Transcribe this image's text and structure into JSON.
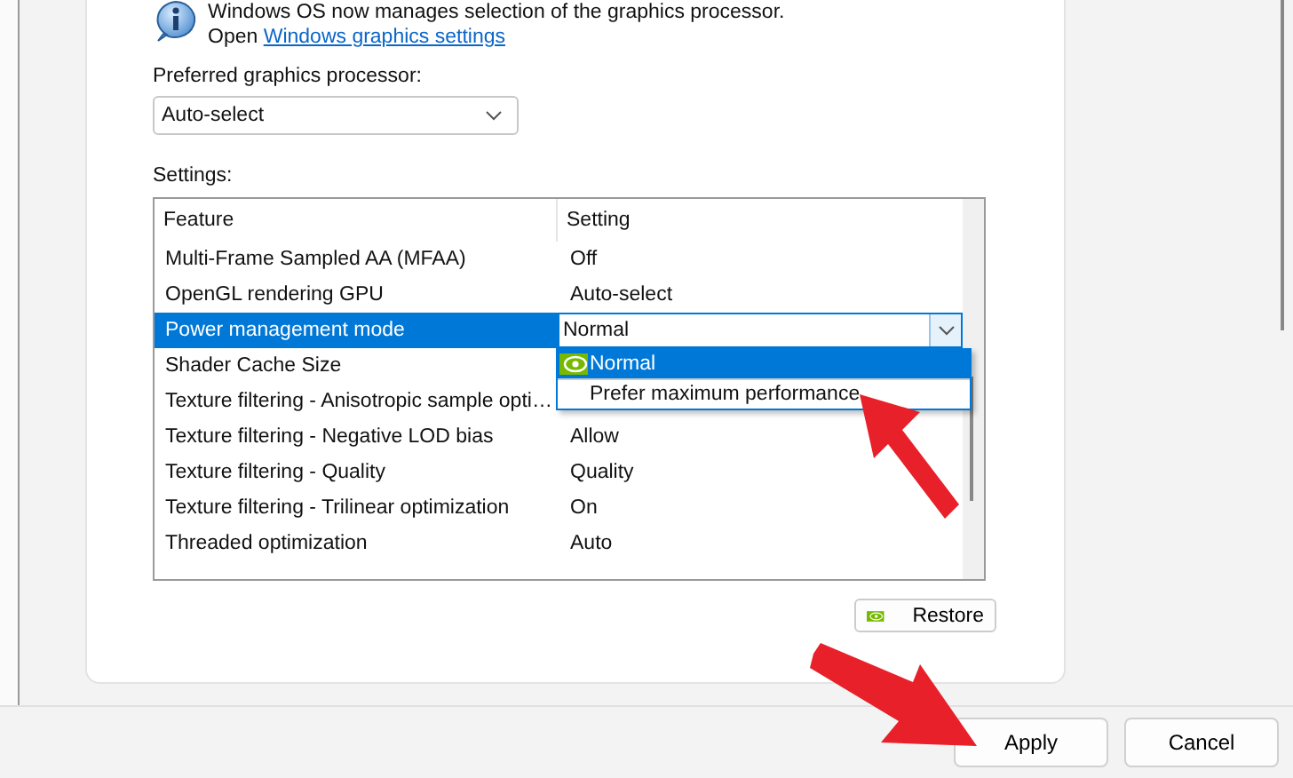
{
  "info": {
    "message": "Windows OS now manages selection of the graphics processor.",
    "link_prefix": "Open",
    "link": "Windows graphics settings"
  },
  "preferred_gpu": {
    "label": "Preferred graphics processor:",
    "value": "Auto-select"
  },
  "settings": {
    "label": "Settings:",
    "columns": [
      "Feature",
      "Setting"
    ],
    "rows": [
      {
        "feature": "Multi-Frame Sampled AA (MFAA)",
        "setting": "Off",
        "selected": false
      },
      {
        "feature": "OpenGL rendering GPU",
        "setting": "Auto-select",
        "selected": false
      },
      {
        "feature": "Power management mode",
        "setting": "Normal",
        "selected": true
      },
      {
        "feature": "Shader Cache Size",
        "setting": "",
        "selected": false
      },
      {
        "feature": "Texture filtering - Anisotropic sample opti…",
        "setting": "",
        "selected": false
      },
      {
        "feature": "Texture filtering - Negative LOD bias",
        "setting": "Allow",
        "selected": false
      },
      {
        "feature": "Texture filtering - Quality",
        "setting": "Quality",
        "selected": false
      },
      {
        "feature": "Texture filtering - Trilinear optimization",
        "setting": "On",
        "selected": false
      },
      {
        "feature": "Threaded optimization",
        "setting": "Auto",
        "selected": false
      }
    ],
    "dropdown_options": [
      {
        "label": "Normal",
        "selected": true
      },
      {
        "label": "Prefer maximum performance",
        "selected": false
      }
    ]
  },
  "restore_button": "Restore",
  "buttons": [
    "Apply",
    "Cancel"
  ]
}
